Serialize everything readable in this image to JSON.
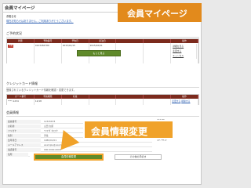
{
  "page": {
    "title": "会員マイページ"
  },
  "callouts": {
    "top": "会員マイページ",
    "mid": "会員情報変更"
  },
  "notice": {
    "label": "お知らせ",
    "text": "現在お知らせはありません。ご利用ありがとうございます。"
  },
  "booking": {
    "heading": "ご予約状況",
    "columns": [
      "状態",
      "予約番号",
      "予約日",
      "宿泊日",
      "",
      "",
      "操作"
    ],
    "row": {
      "status": "予約",
      "number": "0123456789",
      "reserved": "2015/01/15",
      "stay": "2015/02/01",
      "actions": [
        "詳細を見る",
        "変更する",
        "キャンセル"
      ]
    },
    "more_button": "もっと見る"
  },
  "card": {
    "heading": "クレジットカード情報",
    "note": "登録されているクレジットカード情報を確認・変更できます。",
    "columns": [
      "カード番号",
      "有効期限",
      "名義",
      "",
      "",
      "",
      "操作"
    ],
    "row": {
      "number": "****-1234",
      "expiry": "12/18",
      "actions": [
        "変更する",
        "削除する"
      ]
    }
  },
  "profile": {
    "heading": "会員情報",
    "rows": [
      {
        "k": "会員番号",
        "v": "12345678"
      },
      {
        "k": "お名前",
        "v": "山田 太郎"
      },
      {
        "k": "フリガナ",
        "v": "ヤマダ タロウ"
      },
      {
        "k": "性別",
        "v": "男性"
      },
      {
        "k": "生年月日",
        "v": "1980/01/01"
      },
      {
        "k": "メールアドレス",
        "v": "example@example.com"
      },
      {
        "k": "電話番号",
        "v": "000-0000-0000"
      },
      {
        "k": "住所",
        "v": "東京都"
      },
      {
        "k": "パスワード",
        "v": "********"
      },
      {
        "k": "メールマガジン",
        "v": "受け取る"
      }
    ]
  },
  "buttons": {
    "change": "会員情報変更",
    "other": "その他の手続き"
  }
}
